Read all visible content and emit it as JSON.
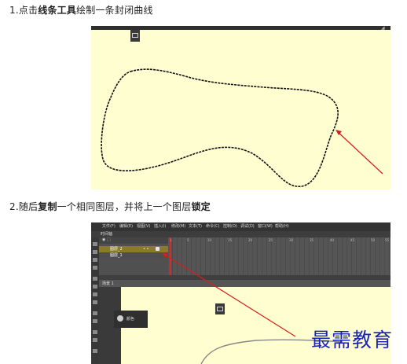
{
  "step1": {
    "prefix": "1.点击",
    "bold": "线条工具",
    "suffix": "绘制一条封闭曲线"
  },
  "step2": {
    "prefix": "2.随后",
    "bold1": "复制",
    "mid": "一个相同图层，并将上一个图层",
    "bold2": "锁定"
  },
  "watermark": "最需教育",
  "shot2": {
    "menu_items": [
      "文件(F)",
      "编辑(E)",
      "视图(V)",
      "插入(I)",
      "修改(M)",
      "文本(T)",
      "命令(C)",
      "控制(O)",
      "调试(D)",
      "窗口(W)",
      "帮助(H)"
    ],
    "panel_title": "时间轴",
    "layers": [
      "图层_2",
      "图层_1"
    ],
    "ruler_marks": [
      "1",
      "5",
      "10",
      "15",
      "20",
      "25",
      "30",
      "35",
      "40",
      "45",
      "50",
      "55"
    ],
    "scene_label": "场景 1",
    "popup_label": "颜色"
  },
  "colors": {
    "stage": "#fffed0",
    "arrow": "#d41f1f",
    "watermark": "#1a23b8",
    "selected_layer": "#8a7a2a"
  }
}
